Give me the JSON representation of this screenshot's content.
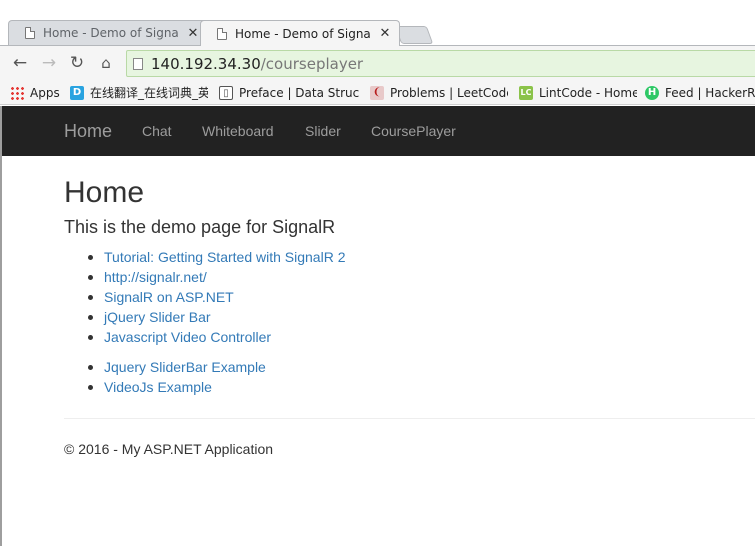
{
  "browser": {
    "tabs": [
      {
        "title": "Home - Demo of SignalR",
        "close": "✕"
      },
      {
        "title": "Home - Demo of SignalR",
        "close": "✕"
      }
    ],
    "url": {
      "host": "140.192.34.30",
      "path": "/courseplayer"
    },
    "bookmarks": [
      {
        "label": "Apps",
        "icon": "apps-grid-icon"
      },
      {
        "label": "在线翻译_在线词典_英",
        "icon": "d-logo-icon",
        "color": "#29a3e0"
      },
      {
        "label": "Preface | Data Structur",
        "icon": "book-icon"
      },
      {
        "label": "Problems | LeetCode O",
        "icon": "leetcode-icon"
      },
      {
        "label": "LintCode - Home",
        "icon": "lc-logo-icon",
        "color": "#8bc34a"
      },
      {
        "label": "Feed | HackerRank",
        "icon": "hackerrank-icon",
        "color": "#2ec866"
      }
    ]
  },
  "navbar": {
    "brand": "Home",
    "links": [
      "Chat",
      "Whiteboard",
      "Slider",
      "CoursePlayer"
    ]
  },
  "main": {
    "title": "Home",
    "lead": "This is the demo page for SignalR",
    "links_group1": [
      "Tutorial: Getting Started with SignalR 2",
      "http://signalr.net/",
      "SignalR on ASP.NET",
      "jQuery Slider Bar",
      "Javascript Video Controller"
    ],
    "links_group2": [
      "Jquery SliderBar Example",
      "VideoJs Example"
    ]
  },
  "footer": {
    "text": "© 2016 - My ASP.NET Application"
  },
  "colors": {
    "navbar_bg": "#222222",
    "link": "#337ab7",
    "omnibox_bg": "#e7f5e0"
  }
}
